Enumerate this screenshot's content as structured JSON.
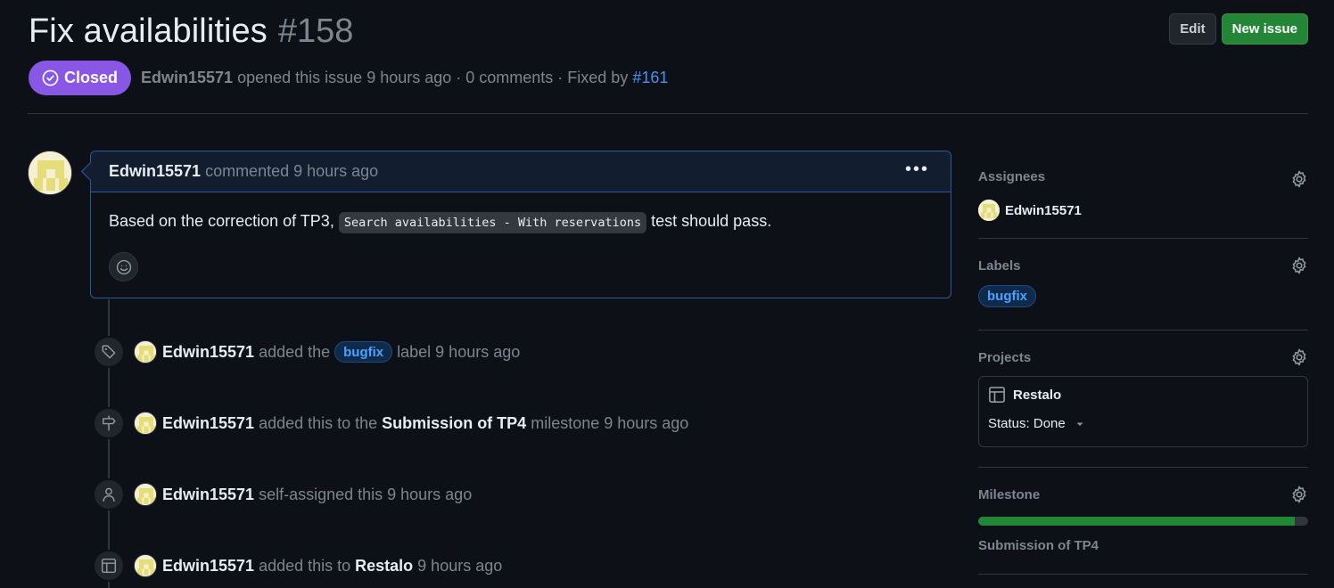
{
  "issue": {
    "title": "Fix availabilities",
    "number": "#158",
    "state": "Closed",
    "author": "Edwin15571",
    "opened_text": "opened this issue 9 hours ago · 0 comments · Fixed by",
    "fixed_by": "#161"
  },
  "header_actions": {
    "edit_label": "Edit",
    "new_issue_label": "New issue"
  },
  "comment": {
    "author": "Edwin15571",
    "action": "commented",
    "when": "9 hours ago",
    "body_before": "Based on the correction of TP3,",
    "body_code": "Search availabilities - With reservations",
    "body_after": "test should pass."
  },
  "timeline": [
    {
      "icon": "tag-icon",
      "author": "Edwin15571",
      "pre": "added the",
      "label": "bugfix",
      "post": "label 9 hours ago"
    },
    {
      "icon": "milestone-icon",
      "author": "Edwin15571",
      "pre": "added this to the",
      "strong": "Submission of TP4",
      "post": "milestone 9 hours ago"
    },
    {
      "icon": "person-icon",
      "author": "Edwin15571",
      "pre": "self-assigned this 9 hours ago"
    },
    {
      "icon": "table-icon",
      "author": "Edwin15571",
      "pre": "added this to",
      "strong": "Restalo",
      "post": "9 hours ago"
    }
  ],
  "sidebar": {
    "assignees": {
      "title": "Assignees",
      "name": "Edwin15571"
    },
    "labels": {
      "title": "Labels",
      "items": [
        "bugfix"
      ]
    },
    "projects": {
      "title": "Projects",
      "name": "Restalo",
      "status": "Status: Done"
    },
    "milestone": {
      "title": "Milestone",
      "name": "Submission of TP4",
      "progress_percent": 96
    }
  },
  "colors": {
    "background": "#0d1117",
    "closed_badge": "#8957e5",
    "new_issue_button": "#238636",
    "link": "#4493f8",
    "label": "#4ba3ff"
  }
}
